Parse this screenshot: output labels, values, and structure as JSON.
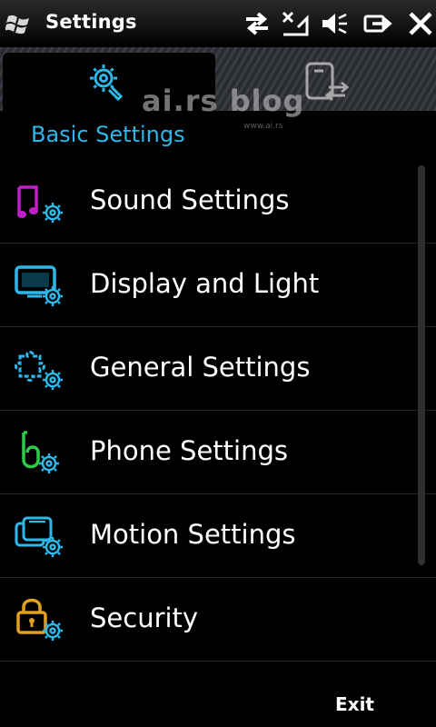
{
  "status_bar": {
    "title": "Settings",
    "icons": [
      "windows-logo-icon",
      "data-connection-icon",
      "no-signal-icon",
      "speaker-muted-icon",
      "battery-icon",
      "close-icon"
    ]
  },
  "tabs": [
    {
      "label": "Basic Settings",
      "icon": "gear-tools-icon",
      "active": true
    },
    {
      "label": "",
      "icon": "device-sync-icon",
      "active": false
    }
  ],
  "watermark": {
    "text": "ai.rs blog",
    "sub": "www.ai.rs"
  },
  "list_items": [
    {
      "label": "Sound Settings",
      "icon": "music-note-gear-icon"
    },
    {
      "label": "Display and Light",
      "icon": "monitor-gear-icon"
    },
    {
      "label": "General Settings",
      "icon": "puzzle-gear-icon"
    },
    {
      "label": "Phone Settings",
      "icon": "phone-gear-icon"
    },
    {
      "label": "Motion Settings",
      "icon": "motion-gear-icon"
    },
    {
      "label": "Security",
      "icon": "padlock-gear-icon"
    }
  ],
  "menu": {
    "right": "Exit"
  },
  "colors": {
    "accent": "#2eb8ea",
    "sound": "#c020c8",
    "display": "#2eb8ea",
    "general": "#2eb8ea",
    "phone": "#2ec84a",
    "motion": "#2eb8ea",
    "security": "#e0a020"
  }
}
